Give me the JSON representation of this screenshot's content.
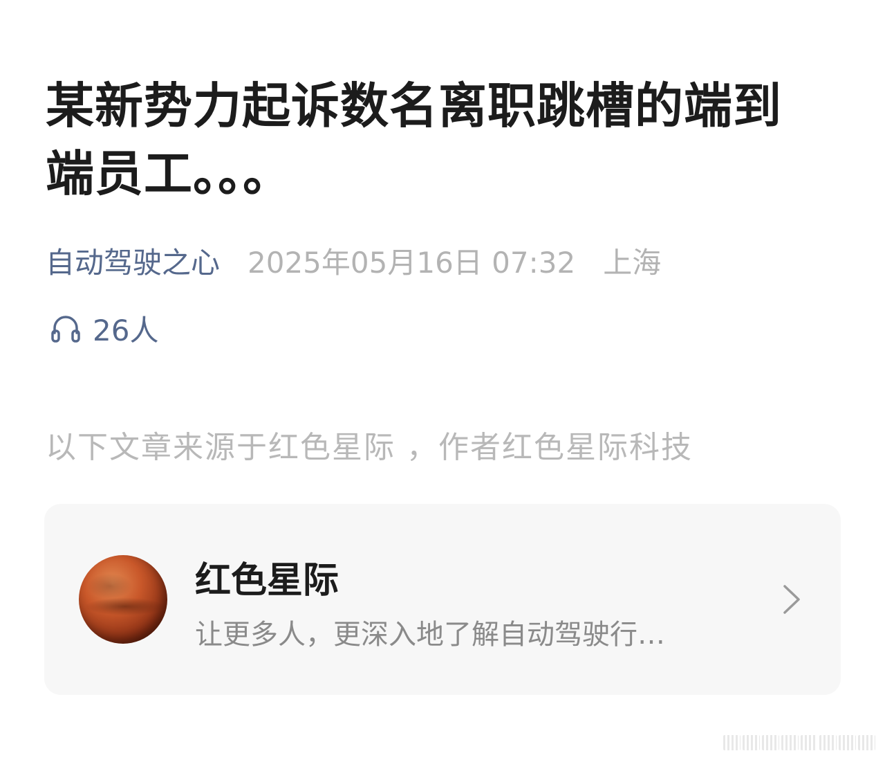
{
  "article": {
    "title": "某新势力起诉数名离职跳槽的端到端员工。。。",
    "account_name": "自动驾驶之心",
    "publish_time": "2025年05月16日 07:32",
    "location": "上海",
    "listen_count": "26人",
    "source_note": "以下文章来源于红色星际 ，作者红色星际科技"
  },
  "source_card": {
    "name": "红色星际",
    "description": "让更多人，更深入地了解自动驾驶行…",
    "avatar_icon": "mars-planet-avatar",
    "chevron_icon": "chevron-right-icon"
  },
  "colors": {
    "link": "#55688c",
    "muted": "#b3b3b3",
    "card_bg": "#f7f7f7"
  }
}
